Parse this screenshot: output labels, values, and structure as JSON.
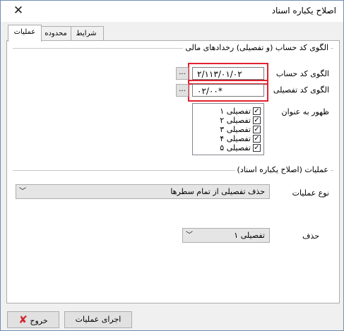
{
  "window": {
    "title": "اصلاح یکباره اسناد"
  },
  "tabs": [
    {
      "label": "عملیات",
      "selected": true
    },
    {
      "label": "محدوده",
      "selected": false
    },
    {
      "label": "شرایط",
      "selected": false
    }
  ],
  "pattern_section": {
    "title": "الگوی کد حساب (و تفصیلی) رخدادهای مالی",
    "account_code_label": "الگوی کد حساب",
    "account_code_value": "۲/۱۱۳/۰۱/۰۲",
    "detail_code_label": "الگوی کد تفصیلی",
    "detail_code_value": "۰۲/۰۰*",
    "browse_label": "...",
    "show_as_label": "ظهور به عنوان",
    "show_as_items": [
      {
        "label": "تفصیلی ۱",
        "checked": true
      },
      {
        "label": "تفصیلی ۲",
        "checked": true
      },
      {
        "label": "تفصیلی ۳",
        "checked": true
      },
      {
        "label": "تفصیلی ۴",
        "checked": true
      },
      {
        "label": "تفصیلی ۵",
        "checked": true
      }
    ]
  },
  "operations_section": {
    "title": "عملیات (اصلاح یکباره اسناد)",
    "operation_type_label": "نوع عملیات",
    "operation_type_value": "حذف تفصیلی از تمام سطرها",
    "delete_label": "حذف",
    "delete_value": "تفصیلی ۱"
  },
  "footer": {
    "exit_label": "خروج",
    "run_label": "اجرای عملیات"
  },
  "colors": {
    "highlight": "#e0232f",
    "exit_icon": "#d1242c"
  }
}
